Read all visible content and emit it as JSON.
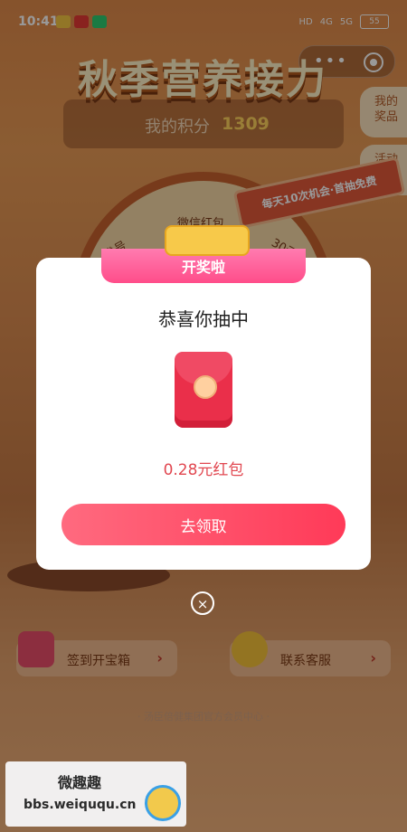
{
  "status_bar": {
    "time": "10:41",
    "battery": "55",
    "network_1": "4G",
    "network_2": "5G",
    "hd": "HD"
  },
  "header": {
    "capsule_more": "•••"
  },
  "background": {
    "title": "秋季营养接力",
    "points_label": "我的积分",
    "points_value": "1309",
    "side_btn_1": "我的奖品",
    "side_btn_2": "活动规则",
    "promo_banner": "每天10次机会·首抽免费",
    "wheel_labels": [
      "微信红包",
      "30元",
      "券号"
    ],
    "checkin_button": "签到开宝箱",
    "service_button": "联系客服",
    "footer_text": "· 汤臣倍健集团官方会员中心 ·"
  },
  "modal": {
    "ribbon_text": "开奖啦",
    "title": "恭喜你抽中",
    "prize": "0.28元红包",
    "claim_button": "去领取",
    "close_symbol": "×"
  },
  "watermark": {
    "top": "微趣趣",
    "bottom": "bbs.weiququ.cn"
  },
  "colors": {
    "accent": "#ff3a58",
    "prize_text": "#e14750",
    "ribbon": "#ff4d8a"
  }
}
